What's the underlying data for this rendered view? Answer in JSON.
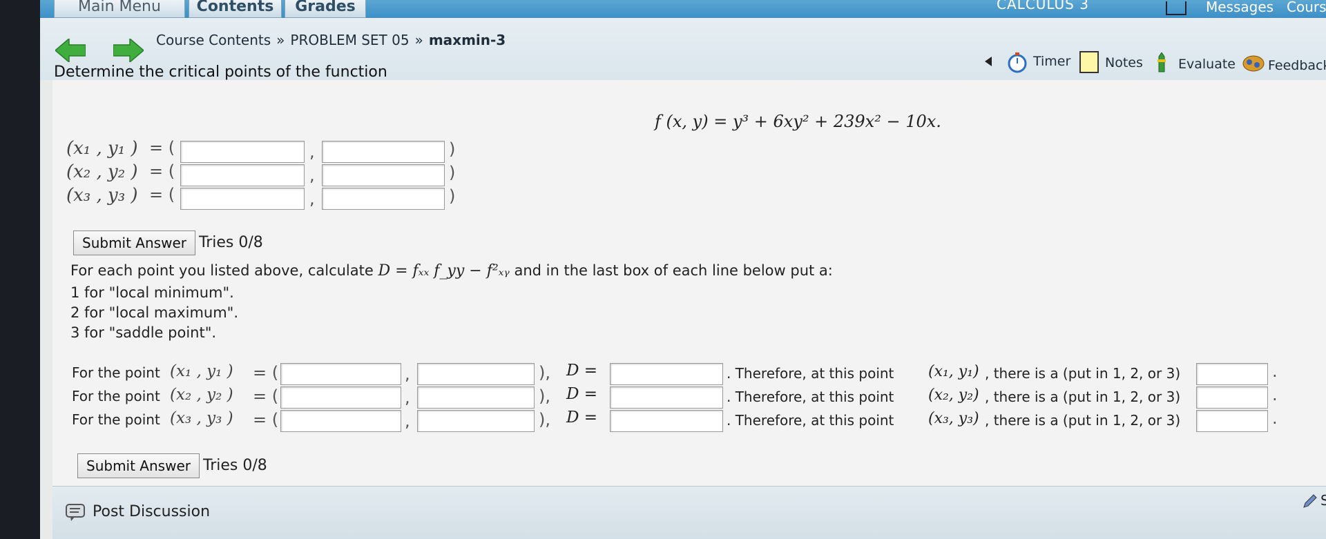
{
  "tabs": {
    "main_menu": "Main Menu",
    "contents": "Contents",
    "grades": "Grades"
  },
  "top_right": {
    "course_code": "CALCULUS 3",
    "messages": "Messages",
    "courses": "Cours"
  },
  "breadcrumb": {
    "course_contents": "Course Contents",
    "sep1": "»",
    "problem_set": "PROBLEM SET 05",
    "sep2": "»",
    "current": "maxmin-3"
  },
  "tools": {
    "timer": "Timer",
    "notes": "Notes",
    "evaluate": "Evaluate",
    "feedback": "Feedback"
  },
  "problem": {
    "prompt": "Determine the critical points of the function",
    "function": "f (x, y) = y³ + 6xy² + 239x² − 10x.",
    "points": [
      {
        "label": "(x₁ , y₁ )"
      },
      {
        "label": "(x₂ , y₂ )"
      },
      {
        "label": "(x₃ , y₃ )"
      }
    ],
    "submit_label": "Submit Answer",
    "tries": "Tries 0/8"
  },
  "part2": {
    "intro_pre": "For each point you listed above, calculate",
    "formula": "D = fₓₓ f_yy − f²ₓᵧ",
    "intro_post": "and in the last box of each line below put a:",
    "options": [
      "1 for \"local minimum\".",
      "2 for \"local maximum\".",
      "3 for \"saddle point\"."
    ],
    "rows": [
      {
        "prefix": "For the point",
        "point": "(x₁ , y₁ )",
        "therefore": ". Therefore, at this point",
        "pt2": "(x₁, y₁)",
        "tail": ", there is a (put in 1, 2, or 3)"
      },
      {
        "prefix": "For the point",
        "point": "(x₂ , y₂ )",
        "therefore": ". Therefore, at this point",
        "pt2": "(x₂, y₂)",
        "tail": ", there is a (put in 1, 2, or 3)"
      },
      {
        "prefix": "For the point",
        "point": "(x₃ , y₃ )",
        "therefore": ". Therefore, at this point",
        "pt2": "(x₃, y₃)",
        "tail": ", there is a (put in 1, 2, or 3)"
      }
    ],
    "d_label": "D =",
    "submit_label": "Submit Answer",
    "tries": "Tries 0/8"
  },
  "discussion": {
    "label": "Post Discussion",
    "right_cut": "S"
  }
}
